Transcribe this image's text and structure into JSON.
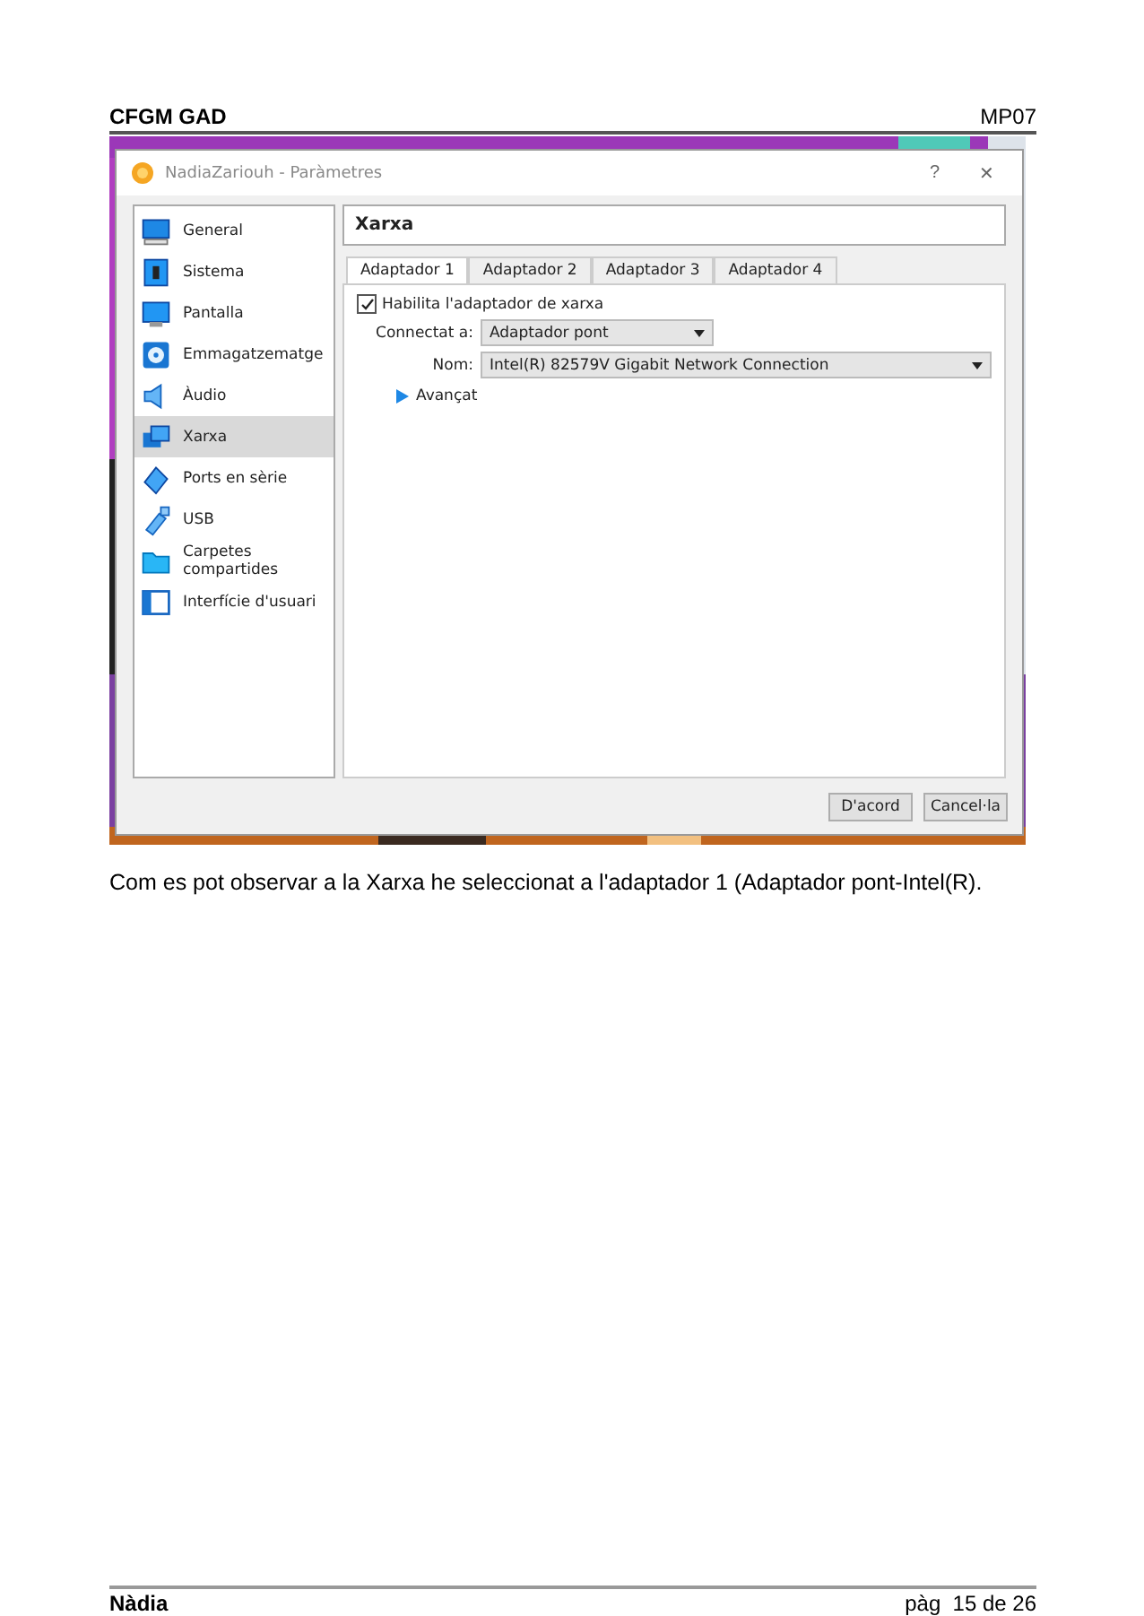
{
  "page_header": {
    "left": "CFGM GAD",
    "right": "MP07"
  },
  "window": {
    "title": "NadiaZariouh - Paràmetres",
    "help": "?",
    "close": "✕"
  },
  "sidebar": {
    "items": [
      {
        "label": "General",
        "selected": false
      },
      {
        "label": "Sistema",
        "selected": false
      },
      {
        "label": "Pantalla",
        "selected": false
      },
      {
        "label": "Emmagatzematge",
        "selected": false
      },
      {
        "label": "Àudio",
        "selected": false
      },
      {
        "label": "Xarxa",
        "selected": true
      },
      {
        "label": "Ports en sèrie",
        "selected": false
      },
      {
        "label": "USB",
        "selected": false
      },
      {
        "label": "Carpetes compartides",
        "selected": false
      },
      {
        "label": "Interfície d'usuari",
        "selected": false
      }
    ]
  },
  "section_title": "Xarxa",
  "tabs": [
    {
      "label": "Adaptador 1",
      "selected": true
    },
    {
      "label": "Adaptador 2",
      "selected": false
    },
    {
      "label": "Adaptador 3",
      "selected": false
    },
    {
      "label": "Adaptador 4",
      "selected": false
    }
  ],
  "enable_checkbox": {
    "label": "Habilita l'adaptador de xarxa",
    "checked": true
  },
  "attached_to": {
    "label": "Connectat a:",
    "value": "Adaptador pont"
  },
  "name": {
    "label": "Nom:",
    "value": "Intel(R) 82579V Gigabit Network Connection"
  },
  "advanced": {
    "label": "Avançat",
    "expanded": false
  },
  "buttons": [
    "D'acord",
    "Cancel·la"
  ],
  "caption": "Com es pot observar a la Xarxa he seleccionat a l'adaptador 1 (Adaptador pont-Intel(R).",
  "page_footer": {
    "left": "Nàdia",
    "right": "pàg  15 de 26"
  }
}
